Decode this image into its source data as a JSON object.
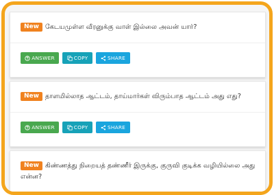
{
  "badge": "New",
  "buttons": {
    "answer": "ANSWER",
    "copy": "COPY",
    "share": "SHARE"
  },
  "questions": [
    {
      "text": "கேடயமுள்ள வீரனுக்கு வாள் இல்லை அவன் யார்?"
    },
    {
      "text": "தாளமில்லாத ஆட்டம், தாய்மார்கள் விரும்பாத ஆட்டம் அது எது?"
    },
    {
      "text": "கிண்ணத்து நிறையத் தண்ணீர் இருக்கு, குருவி குடிக்க வழியில்லை அது என்ன?"
    }
  ],
  "colors": {
    "frame": "#f4a51c",
    "badge": "#f0821f",
    "answer": "#49a84f",
    "copy": "#17a2b8",
    "share": "#1aa5de"
  },
  "icons": [
    "question-circle-icon",
    "copy-icon",
    "share-icon"
  ]
}
